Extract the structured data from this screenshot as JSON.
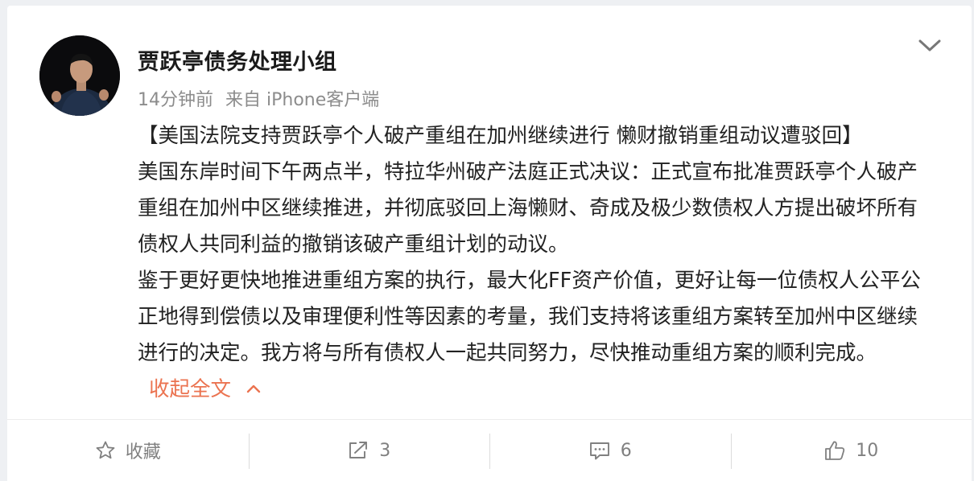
{
  "post": {
    "author": "贾跃亭债务处理小组",
    "time": "14分钟前",
    "source": "来自 iPhone客户端",
    "title_line": "【美国法院支持贾跃亭个人破产重组在加州继续进行 懒财撤销重组动议遭驳回】",
    "paragraph1": "美国东岸时间下午两点半，特拉华州破产法庭正式决议：正式宣布批准贾跃亭个人破产重组在加州中区继续推进，并彻底驳回上海懒财、奇成及极少数债权人方提出破坏所有债权人共同利益的撤销该破产重组计划的动议。",
    "paragraph2": "鉴于更好更快地推进重组方案的执行，最大化FF资产价值，更好让每一位债权人公平公正地得到偿债以及审理便利性等因素的考量，我们支持将该重组方案转至加州中区继续进行的决定。我方将与所有债权人一起共同努力，尽快推动重组方案的顺利完成。",
    "collapse_label": "收起全文"
  },
  "actions": {
    "favorite_label": "收藏",
    "repost_count": "3",
    "comment_count": "6",
    "like_count": "10"
  },
  "icons": {
    "menu": "chevron-down-icon",
    "collapse": "chevron-up-icon",
    "favorite": "star-icon",
    "repost": "share-arrow-icon",
    "comment": "comment-bubble-icon",
    "like": "thumbs-up-icon"
  },
  "colors": {
    "accent_link": "#eb7350",
    "meta_text": "#8c8c8c",
    "body_text": "#222222"
  }
}
